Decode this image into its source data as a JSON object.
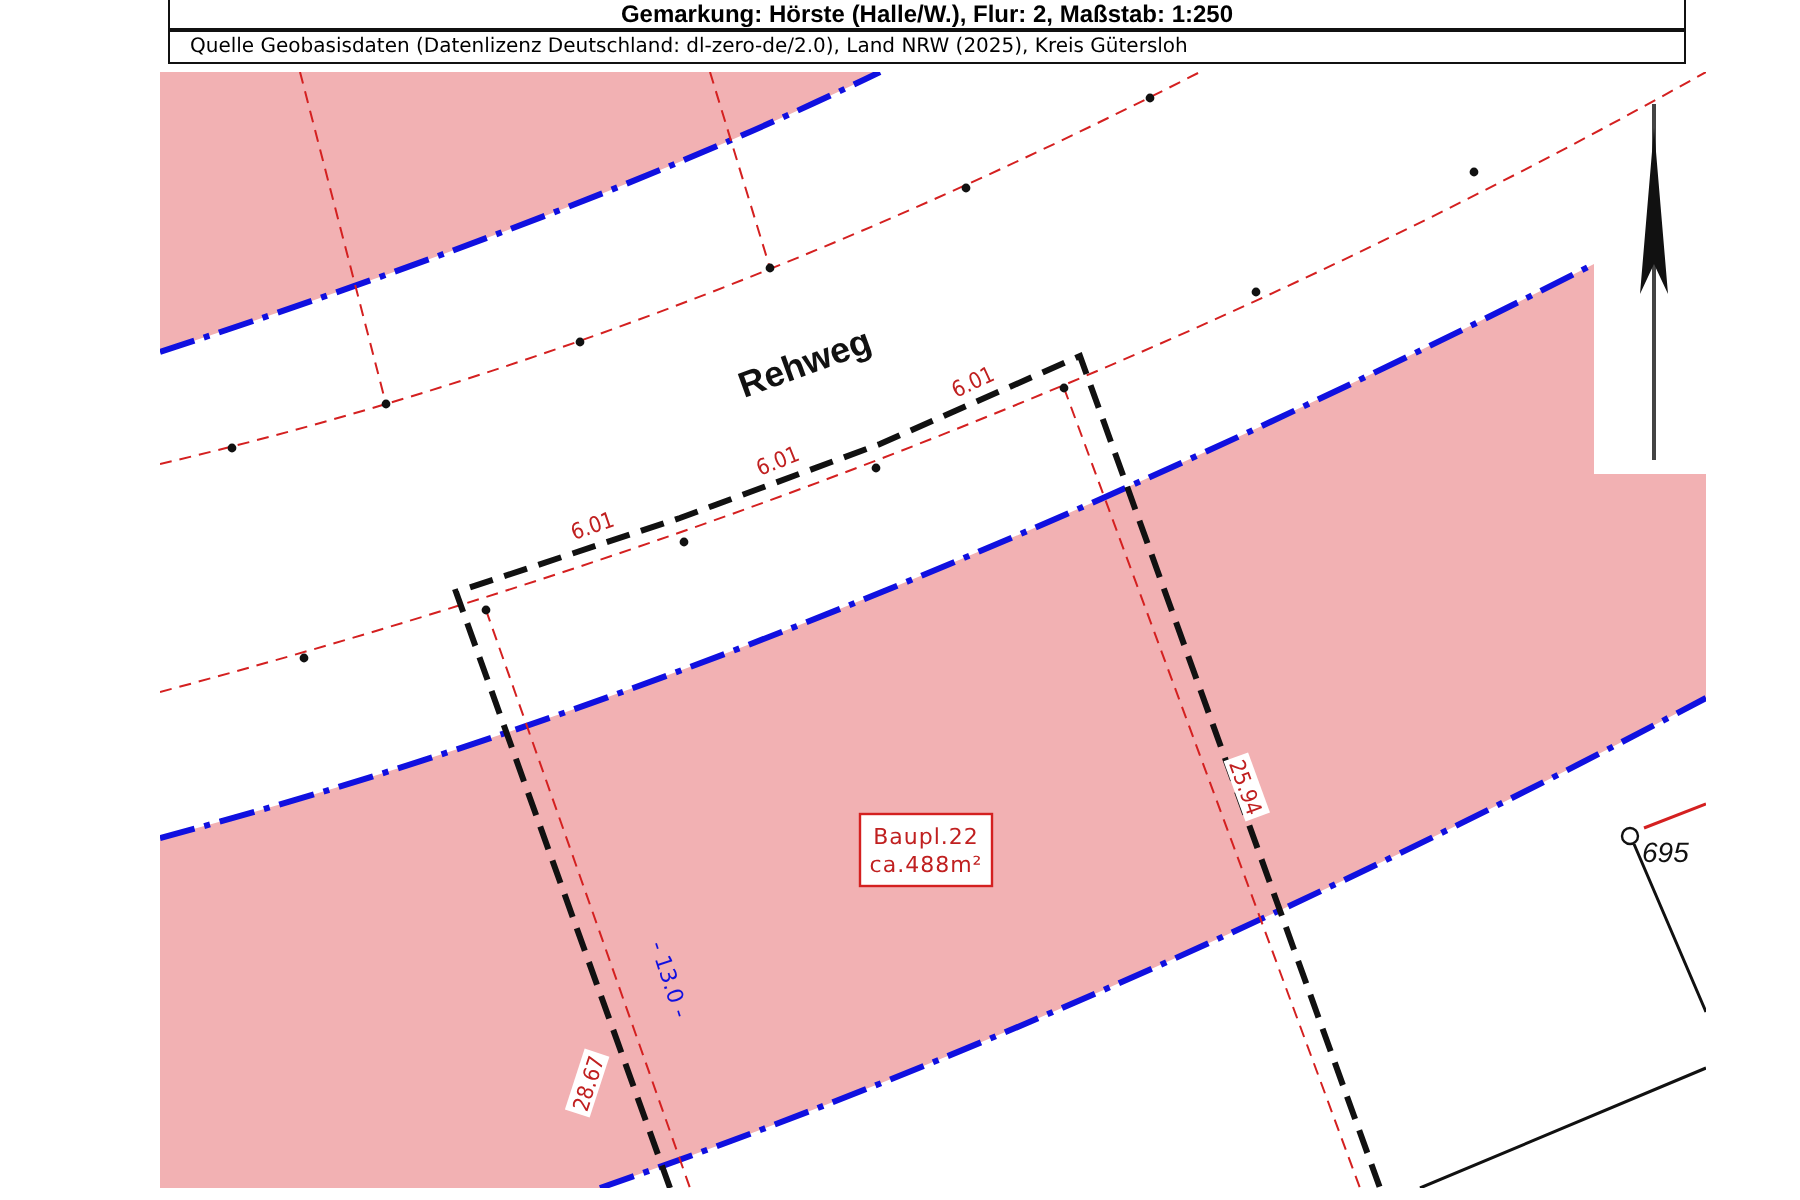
{
  "header": {
    "title": "Gemarkung: Hörste (Halle/W.), Flur: 2, Maßstab: 1:250",
    "source": "Quelle Geobasisdaten (Datenlizenz Deutschland: dl-zero-de/2.0), Land NRW (2025), Kreis Gütersloh"
  },
  "map": {
    "street_name": "Rehweg",
    "front_dimensions": [
      "6.01",
      "6.01",
      "6.01"
    ],
    "side_dimensions": [
      "25.94",
      "28.67"
    ],
    "setback_label": "- 13.0 -",
    "plot_label": [
      "Baupl.22",
      "ca.488m²"
    ],
    "parcel_number": "695"
  }
}
